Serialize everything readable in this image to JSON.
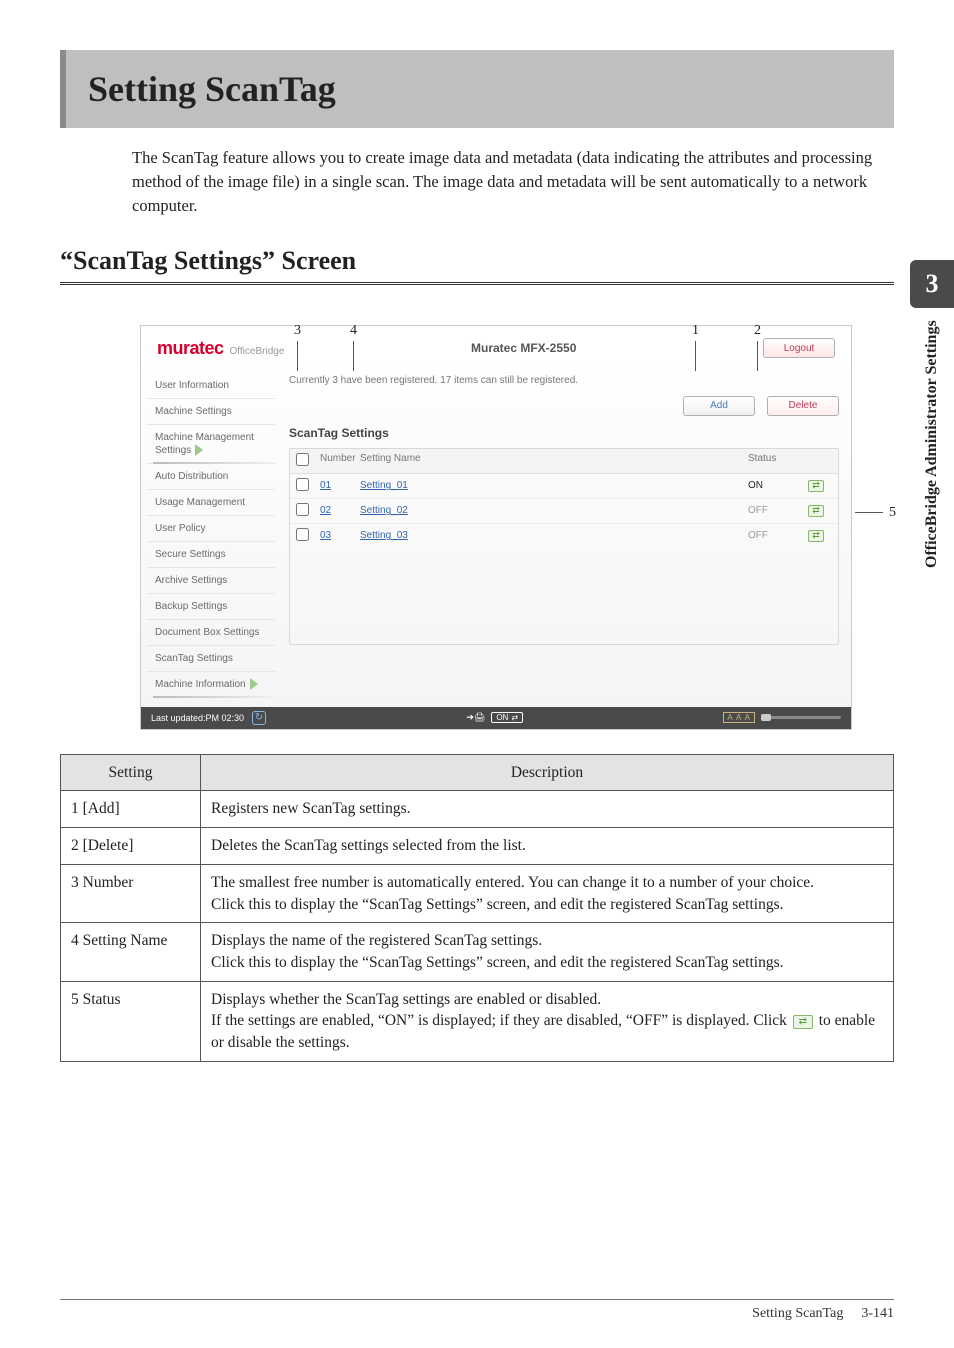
{
  "side_tab": "3",
  "side_label": "OfficeBridge Administrator Settings",
  "page_title": "Setting ScanTag",
  "intro": "The ScanTag feature allows you to create image data and metadata (data indicating the attributes and processing method of the image file) in a single scan. The image data and metadata will be sent automatically to a network computer.",
  "subheading": "“ScanTag Settings” Screen",
  "callouts": {
    "c1": "1",
    "c2": "2",
    "c3": "3",
    "c4": "4",
    "c5": "5"
  },
  "app": {
    "brand_main": "muratec",
    "brand_sub": "OfficeBridge",
    "model": "Muratec MFX-2550",
    "logout": "Logout",
    "message": "Currently 3 have been registered. 17 items can still be registered.",
    "add_btn": "Add",
    "delete_btn": "Delete",
    "panel_title": "ScanTag Settings",
    "head_number": "Number",
    "head_name": "Setting Name",
    "head_status": "Status",
    "rows": [
      {
        "num": "01",
        "name": "Setting_01",
        "status": "ON"
      },
      {
        "num": "02",
        "name": "Setting_02",
        "status": "OFF"
      },
      {
        "num": "03",
        "name": "Setting_03",
        "status": "OFF"
      }
    ],
    "sidebar": [
      "User Information",
      "Machine Settings",
      "Machine Management Settings",
      "Auto Distribution",
      "Usage Management",
      "User Policy",
      "Secure Settings",
      "Archive Settings",
      "Backup Settings",
      "Document Box Settings",
      "ScanTag Settings",
      "Machine Information"
    ],
    "statusbar_time": "Last updated:PM 02:30",
    "statusbar_on": "ON",
    "statusbar_aaa": "A A A"
  },
  "table": {
    "head_setting": "Setting",
    "head_desc": "Description",
    "rows": [
      {
        "s": "1 [Add]",
        "d": "Registers new ScanTag settings."
      },
      {
        "s": "2 [Delete]",
        "d": "Deletes the ScanTag settings selected from the list."
      },
      {
        "s": "3 Number",
        "d": "The smallest free number is automatically entered. You can change it to a number of your choice.\nClick this to display the “ScanTag Settings” screen, and edit the registered ScanTag settings."
      },
      {
        "s": "4 Setting Name",
        "d": "Displays the name of the registered ScanTag settings.\nClick this to display the “ScanTag Settings” screen, and edit the registered ScanTag settings."
      },
      {
        "s": "5 Status",
        "d_pre": "Displays whether the ScanTag settings are enabled or disabled.\nIf the settings are enabled, “ON” is displayed; if they are disabled, “OFF” is displayed. Click ",
        "d_post": " to enable or disable the settings."
      }
    ]
  },
  "footer_title": "Setting ScanTag",
  "footer_page": "3-141"
}
